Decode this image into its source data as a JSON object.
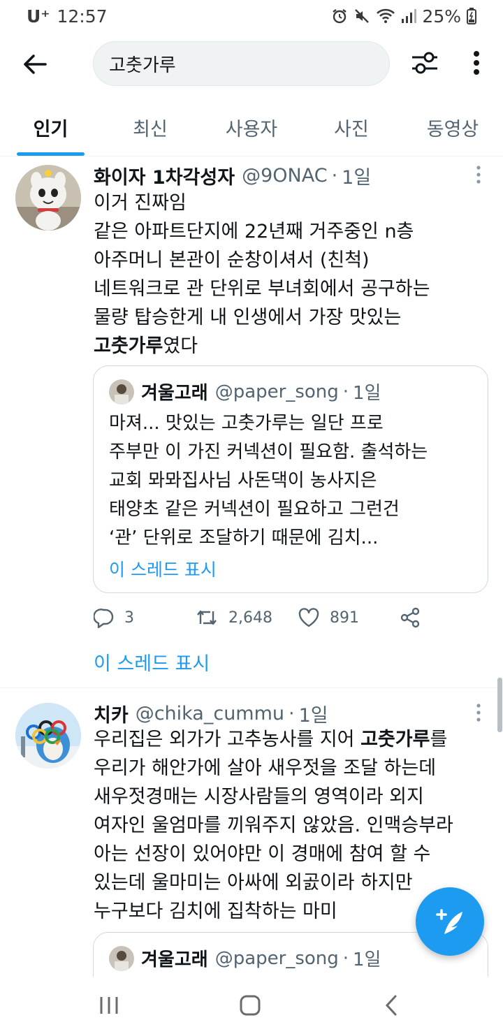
{
  "status_bar": {
    "carrier": "U⁺",
    "time": "12:57",
    "battery": "25%"
  },
  "search": {
    "query": "고춧가루"
  },
  "tabs": [
    {
      "label": "인기",
      "active": true
    },
    {
      "label": "최신",
      "active": false
    },
    {
      "label": "사용자",
      "active": false
    },
    {
      "label": "사진",
      "active": false
    },
    {
      "label": "동영상",
      "active": false
    }
  ],
  "tweets": [
    {
      "name": "화이자 1차각성자",
      "handle": "@9ONAC",
      "sep": "·",
      "time": "1일",
      "lines": [
        "이거 진짜임",
        "같은 아파트단지에 22년째 거주중인 n층",
        "아주머니 본관이 순창이셔서 (친척)",
        "네트워크로 관 단위로 부녀회에서 공구하는",
        "물량 탑승한게 내 인생에서 가장 맛있는"
      ],
      "last_bold": "고춧가루",
      "last_rest": "였다",
      "quote": {
        "name": "겨울고래",
        "handle": "@paper_song",
        "sep": "·",
        "time": "1일",
        "lines": [
          "마져... 맛있는 고춧가루는 일단 프로",
          "주부만 이 가진 커넥션이 필요함. 출석하는",
          "교회 뫄뫄집사님 사돈댁이 농사지은",
          "태양초 같은 커넥션이 필요하고 그런건",
          "‘관’ 단위로 조달하기 때문에 김치..."
        ],
        "show_thread": "이 스레드 표시"
      },
      "replies": "3",
      "retweets": "2,648",
      "likes": "891",
      "show_thread": "이 스레드 표시"
    },
    {
      "name": "치카",
      "handle": "@chika_cummu",
      "sep": "·",
      "time": "1일",
      "first_pre": "우리집은 외가가 고추농사를 지어 ",
      "first_bold": "고춧가루",
      "first_post": "를",
      "lines": [
        "우리가 해안가에 살아 새우젓을 조달 하는데",
        "새우젓경매는 시장사람들의 영역이라 외지",
        "여자인 울엄마를 끼워주지 않았음. 인맥승부라",
        "아는 선장이 있어야만 이 경매에 참여 할 수",
        "있는데 울마미는 아싸에 외곬이라 하지만",
        "누구보다 김치에 집착하는 마미"
      ],
      "quote": {
        "name": "겨울고래",
        "handle": "@paper_song",
        "sep": "·",
        "time": "1일"
      }
    }
  ],
  "colors": {
    "accent": "#1d9bf0",
    "text": "#0f1419",
    "muted": "#536471"
  }
}
